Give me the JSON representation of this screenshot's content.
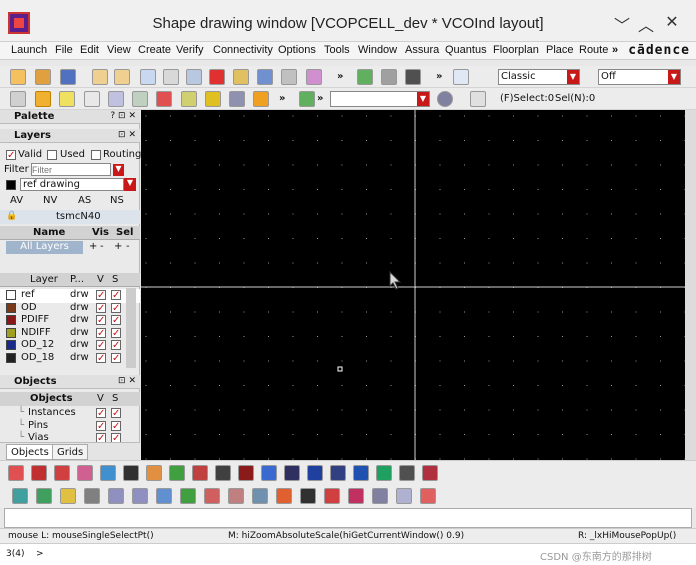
{
  "window": {
    "title": "Shape drawing window [VCOPCELL_dev * VCOInd layout]",
    "minimize": "﹀",
    "maximize": "︿",
    "close": "✕"
  },
  "menu": {
    "items": [
      "Launch",
      "File",
      "Edit",
      "View",
      "Create",
      "Verify",
      "Connectivity",
      "Options",
      "Tools",
      "Window",
      "Assura",
      "Quantus",
      "Floorplan",
      "Place",
      "Route"
    ],
    "more": "»",
    "brand": "cādence"
  },
  "toolbar1": {
    "more1": "»",
    "more2": "»",
    "mode_value": "Classic",
    "off_value": "Off"
  },
  "toolbar2": {
    "more1": "»",
    "more2": "»",
    "select_status": "(F)Select:0",
    "sel_n_status": "Sel(N):0"
  },
  "palette": {
    "title": "Palette",
    "title_ctrl": "? ⊡ ✕",
    "layers_title": "Layers",
    "layers_ctrl": "⊡ ✕",
    "valid_label": "Valid",
    "used_label": "Used",
    "routing_label": "Routing",
    "filter_label": "Filter",
    "filter_placeholder": "Filter",
    "current_layer": "ref drawing",
    "av": "AV",
    "nv": "NV",
    "as": "AS",
    "ns": "NS",
    "tech": "tsmcN40",
    "name_header": "Name",
    "vis_header": "Vis",
    "sel_header": "Sel",
    "all_layers": "All Layers",
    "plus": "+",
    "minus": "-",
    "layer_header": "Layer",
    "purpose_header": "P...",
    "v_header": "V",
    "s_header": "S",
    "layers": [
      {
        "name": "ref",
        "purpose": "drw",
        "color": "#ffffff"
      },
      {
        "name": "OD",
        "purpose": "drw",
        "color": "#7a3a1a"
      },
      {
        "name": "PDIFF",
        "purpose": "drw",
        "color": "#8a1818"
      },
      {
        "name": "NDIFF",
        "purpose": "drw",
        "color": "#a0a020"
      },
      {
        "name": "OD_12",
        "purpose": "drw",
        "color": "#1a2a8a"
      },
      {
        "name": "OD_18",
        "purpose": "drw",
        "color": "#222222"
      }
    ],
    "objects_title": "Objects",
    "objects_ctrl": "⊡ ✕",
    "objects_header": "Objects",
    "objects": [
      "Instances",
      "Pins",
      "Vias"
    ],
    "tabs": [
      "Objects",
      "Grids"
    ]
  },
  "status": {
    "mouse_l": "mouse L: mouseSingleSelectPt()",
    "mouse_m": "M: hiZoomAbsoluteScale(hiGetCurrentWindow() 0.9)",
    "mouse_r": "R: _lxHiMousePopUp()",
    "prompt_index": "3(4)",
    "prompt": ">",
    "watermark": "CSDN @东南方的那排树"
  }
}
